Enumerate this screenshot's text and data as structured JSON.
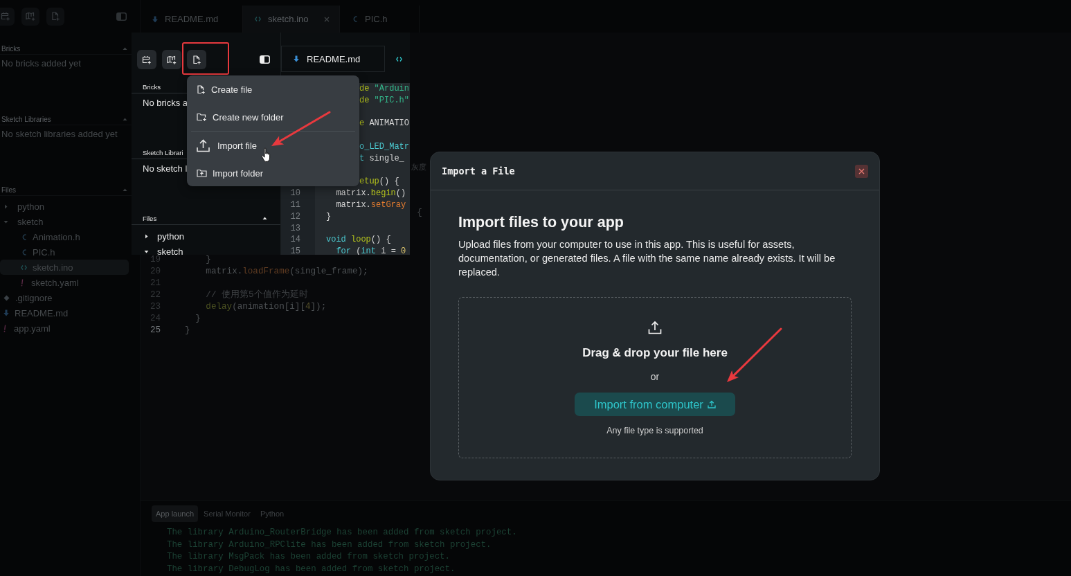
{
  "background_ide": {
    "toolbar": [
      {
        "kind": "bricks"
      },
      {
        "kind": "library"
      },
      {
        "kind": "new-file"
      }
    ],
    "sections": [
      {
        "title": "Bricks",
        "expanded": true,
        "empty_text": "No bricks added yet"
      },
      {
        "title": "Sketch Libraries",
        "expanded": true,
        "empty_text": "No sketch libraries added yet"
      },
      {
        "title": "Files",
        "expanded": true
      }
    ],
    "files": [
      {
        "name": "python",
        "kind": "folder",
        "expanded": false,
        "selected": false
      },
      {
        "name": "sketch",
        "kind": "folder",
        "expanded": true,
        "selected": false,
        "children": [
          {
            "name": "Animation.h",
            "kind": "c",
            "selected": false
          },
          {
            "name": "PIC.h",
            "kind": "c",
            "selected": false
          },
          {
            "name": "sketch.ino",
            "kind": "ino",
            "selected": true
          },
          {
            "name": "sketch.yaml",
            "kind": "yaml",
            "selected": false
          }
        ]
      },
      {
        "name": ".gitignore",
        "kind": "git",
        "selected": false
      },
      {
        "name": "README.md",
        "kind": "md",
        "selected": false
      },
      {
        "name": "app.yaml",
        "kind": "yaml",
        "selected": false
      }
    ],
    "tabs": [
      {
        "label": "README.md",
        "kind": "md",
        "selected": false,
        "closable": false
      },
      {
        "label": "sketch.ino",
        "kind": "ino",
        "selected": true,
        "closable": true
      },
      {
        "label": "PIC.h",
        "kind": "c",
        "selected": false,
        "closable": false
      }
    ],
    "code_fragments": [
      "灰度",
      "{"
    ],
    "code": [
      {
        "number": "19",
        "current": false,
        "tokens": [
          {
            "kind": "plain",
            "text": "      }"
          }
        ]
      },
      {
        "number": "20",
        "current": false,
        "tokens": [
          {
            "kind": "plain",
            "text": "      matrix."
          },
          {
            "kind": "method",
            "text": "loadFrame"
          },
          {
            "kind": "plain",
            "text": "(single_frame);"
          }
        ]
      },
      {
        "number": "21",
        "current": false
      },
      {
        "number": "22",
        "current": false,
        "tokens": [
          {
            "kind": "comment",
            "text": "      // 使用第5个值作为延时"
          }
        ]
      },
      {
        "number": "23",
        "current": false,
        "tokens": [
          {
            "kind": "function",
            "text": "      delay"
          },
          {
            "kind": "plain",
            "text": "(animation[i]["
          },
          {
            "kind": "number",
            "text": "4"
          },
          {
            "kind": "plain",
            "text": "]);"
          }
        ]
      },
      {
        "number": "24",
        "current": false,
        "tokens": [
          {
            "kind": "plain",
            "text": "    }"
          }
        ]
      },
      {
        "number": "25",
        "current": true,
        "tokens": [
          {
            "kind": "plain",
            "text": "  }"
          }
        ]
      }
    ],
    "console": {
      "tabs": [
        {
          "label": "App launch",
          "selected": true
        },
        {
          "label": "Serial Monitor",
          "selected": false
        },
        {
          "label": "Python",
          "selected": false
        }
      ],
      "lines": [
        "The library Arduino_RouterBridge has been added from sketch project.",
        "The library Arduino_RPClite has been added from sketch project.",
        "The library MsgPack has been added from sketch project.",
        "The library DebugLog has been added from sketch project."
      ]
    }
  },
  "inset": {
    "toolbar": [
      {
        "kind": "bricks",
        "highlighted": false
      },
      {
        "kind": "library",
        "highlighted": false
      },
      {
        "kind": "new-file",
        "highlighted": true
      }
    ],
    "sections": [
      {
        "title": "Bricks",
        "empty_text": "No bricks a"
      },
      {
        "title": "Sketch Librari",
        "empty_text": "No sketch l"
      },
      {
        "title": "Files",
        "expanded": true
      }
    ],
    "files": [
      {
        "name": "python",
        "expanded": false,
        "selected": false
      },
      {
        "name": "sketch",
        "expanded": true,
        "selected": false
      }
    ],
    "tabs": [
      {
        "label": "README.md",
        "kind": "md",
        "selected": false
      },
      {
        "kind": "ino",
        "selected": false
      }
    ],
    "code_behind_menu": [
      {
        "kind": "code",
        "tokens": [
          {
            "kind": "preprocessor",
            "text": "de"
          },
          {
            "kind": "string",
            "text": " \"Arduin"
          }
        ]
      },
      {
        "kind": "code",
        "tokens": [
          {
            "kind": "preprocessor",
            "text": "de"
          },
          {
            "kind": "string",
            "text": " \"PIC.h\""
          }
        ]
      },
      {
        "kind": "blank"
      },
      {
        "kind": "code",
        "tokens": [
          {
            "kind": "preprocessor",
            "text": "e"
          },
          {
            "kind": "plain",
            "text": " ANIMATIO"
          }
        ]
      },
      {
        "kind": "blank"
      },
      {
        "kind": "code",
        "tokens": [
          {
            "kind": "type",
            "text": "o_LED_Matr"
          }
        ]
      },
      {
        "kind": "code",
        "tokens": [
          {
            "kind": "type",
            "text": "t"
          },
          {
            "kind": "plain",
            "text": " single_"
          }
        ]
      },
      {
        "kind": "blank"
      },
      {
        "kind": "code",
        "tokens": [
          {
            "kind": "function",
            "text": "etup"
          },
          {
            "kind": "plain",
            "text": "() {"
          }
        ]
      }
    ],
    "code": [
      {
        "number": "10",
        "tokens": [
          {
            "kind": "plain",
            "text": "  matrix."
          },
          {
            "kind": "function",
            "text": "begin"
          },
          {
            "kind": "plain",
            "text": "()"
          }
        ]
      },
      {
        "number": "11",
        "tokens": [
          {
            "kind": "plain",
            "text": "  matrix."
          },
          {
            "kind": "method",
            "text": "setGray"
          }
        ]
      },
      {
        "number": "12",
        "tokens": [
          {
            "kind": "plain",
            "text": "}"
          }
        ]
      },
      {
        "number": "13"
      },
      {
        "number": "14",
        "tokens": [
          {
            "kind": "type",
            "text": "void"
          },
          {
            "kind": "function",
            "text": " loop"
          },
          {
            "kind": "plain",
            "text": "() {"
          }
        ]
      },
      {
        "number": "15",
        "tokens": [
          {
            "kind": "type",
            "text": "  for"
          },
          {
            "kind": "plain",
            "text": " ("
          },
          {
            "kind": "type",
            "text": "int"
          },
          {
            "kind": "plain",
            "text": " i = "
          },
          {
            "kind": "number",
            "text": "0"
          }
        ]
      }
    ]
  },
  "menu": {
    "items": [
      {
        "kind": "file-plus",
        "label": "Create file"
      },
      {
        "kind": "folder-plus",
        "label": "Create new folder"
      },
      {
        "kind": "divider"
      },
      {
        "kind": "upload",
        "label": "Import file"
      },
      {
        "kind": "folder-upload",
        "label": "Import folder"
      }
    ]
  },
  "dialog": {
    "title": "Import a File",
    "heading": "Import files to your app",
    "description": "Upload files from your computer to use in this app. This is useful for assets, documentation, or generated files. A file with the same name already exists. It will be replaced.",
    "dropzone": {
      "prompt": "Drag & drop your file here",
      "separator": "or",
      "button": "Import from computer",
      "note": "Any file type is supported"
    }
  }
}
